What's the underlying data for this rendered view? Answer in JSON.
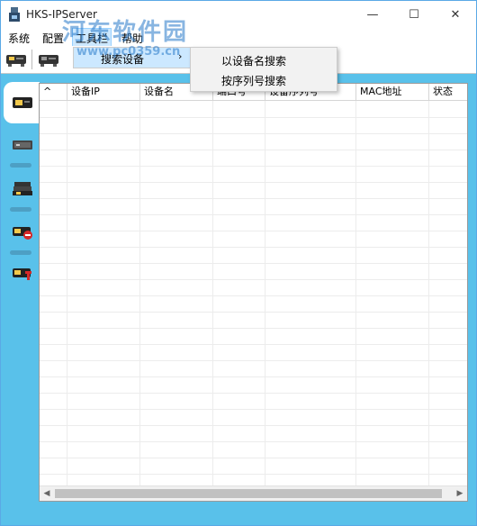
{
  "window": {
    "title": "HKS-IPServer",
    "minimize_glyph": "—",
    "maximize_glyph": "☐",
    "close_glyph": "✕"
  },
  "menu": {
    "items": [
      {
        "label": "系统"
      },
      {
        "label": "配置"
      },
      {
        "label": "工具栏"
      },
      {
        "label": "帮助"
      }
    ],
    "submenu": {
      "label": "搜索设备",
      "arrow": "›"
    },
    "flyout": [
      {
        "label": "以设备名搜索"
      },
      {
        "label": "按序列号搜索"
      }
    ]
  },
  "table": {
    "columns": [
      "^",
      "设备IP",
      "设备名",
      "端口号",
      "设备序列号",
      "MAC地址",
      "状态"
    ],
    "rows": []
  },
  "scroll": {
    "left_arrow": "◀",
    "right_arrow": "▶"
  },
  "watermark": {
    "line1": "河东软件园",
    "line2": "www.pc0359.cn"
  },
  "colors": {
    "accent": "#59c1ea",
    "menu_highlight": "#cce8ff"
  },
  "icons": {
    "toolbar": [
      "device-connect-icon",
      "device-disconnect-icon"
    ],
    "sidebar": [
      "device-list-icon",
      "device-single-icon",
      "device-group-icon",
      "device-remove-icon",
      "device-alarm-icon"
    ]
  }
}
